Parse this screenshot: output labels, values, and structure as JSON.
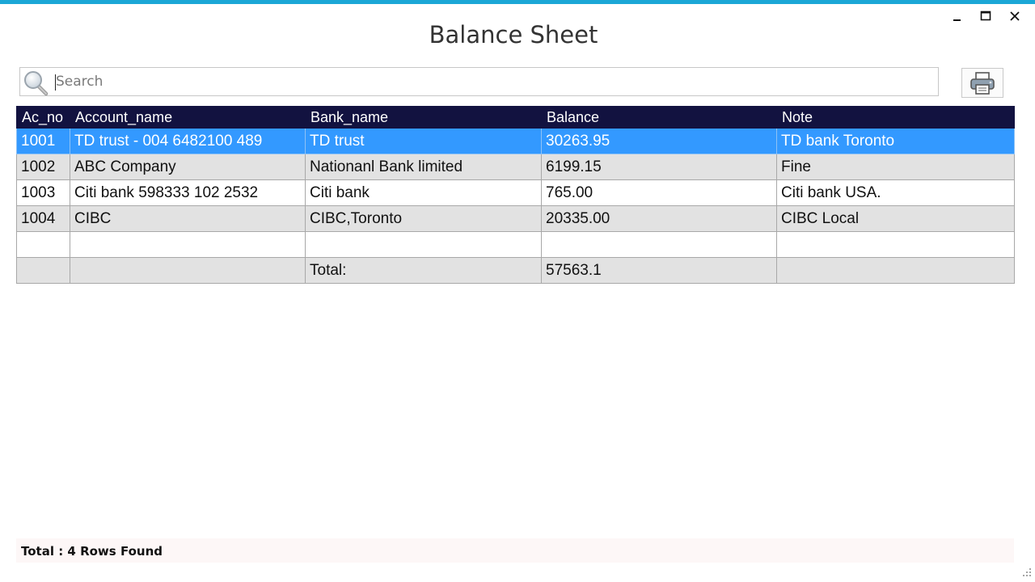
{
  "window": {
    "title": "Balance Sheet",
    "accent_color": "#1ba7d6",
    "controls": [
      "minimize-icon",
      "maximize-icon",
      "close-icon"
    ]
  },
  "search": {
    "placeholder": "Search",
    "value": "",
    "icon": "search-icon"
  },
  "toolbar": {
    "print_icon": "printer-icon"
  },
  "table": {
    "header_color": "#121240",
    "selected_color": "#3399ff",
    "columns": [
      "Ac_no",
      "Account_name",
      "Bank_name",
      "Balance",
      "Note"
    ],
    "rows": [
      {
        "ac_no": "1001",
        "account_name": "TD trust - 004 6482100 489",
        "bank_name": "TD trust",
        "balance": "30263.95",
        "note": "TD bank Toronto",
        "selected": true
      },
      {
        "ac_no": "1002",
        "account_name": "ABC Company",
        "bank_name": "Nationanl Bank limited",
        "balance": "6199.15",
        "note": "Fine",
        "selected": false
      },
      {
        "ac_no": "1003",
        "account_name": "Citi bank 598333 102 2532",
        "bank_name": "Citi bank",
        "balance": "765.00",
        "note": "Citi bank USA.",
        "selected": false
      },
      {
        "ac_no": "1004",
        "account_name": "CIBC",
        "bank_name": "CIBC,Toronto",
        "balance": "20335.00",
        "note": "CIBC Local",
        "selected": false
      }
    ],
    "total": {
      "label": "Total:",
      "value": "57563.1"
    }
  },
  "footer": {
    "status": "Total : 4 Rows Found"
  }
}
